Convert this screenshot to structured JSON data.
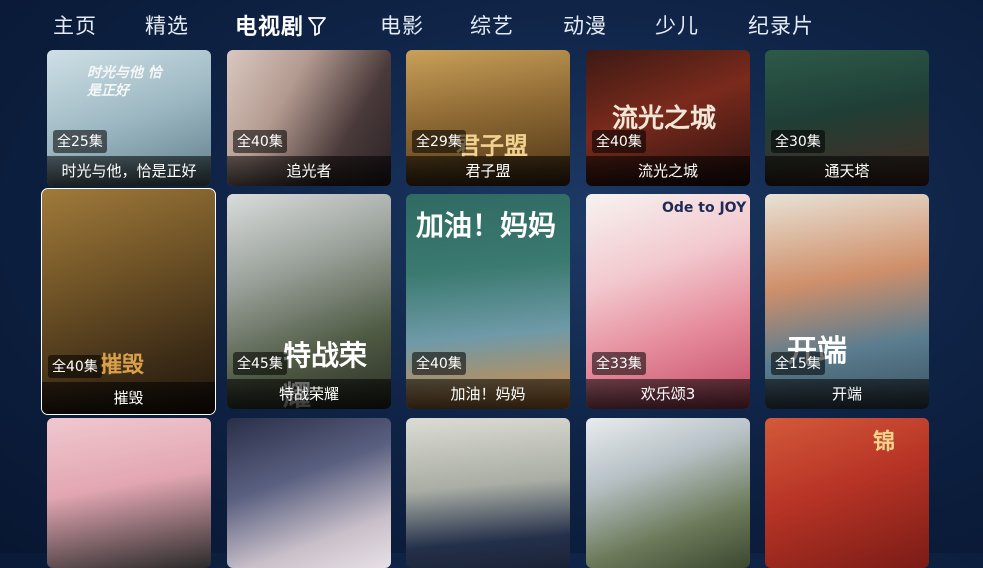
{
  "nav": {
    "items": [
      {
        "label": "主页"
      },
      {
        "label": "精选"
      },
      {
        "label": "电视剧"
      },
      {
        "label": "电影"
      },
      {
        "label": "综艺"
      },
      {
        "label": "动漫"
      },
      {
        "label": "少儿"
      },
      {
        "label": "纪录片"
      }
    ],
    "active_index": 2
  },
  "rows": [
    [
      {
        "title": "时光与他，恰是正好",
        "episodes": "全25集",
        "poster_text": "时光与他 恰是正好"
      },
      {
        "title": "追光者",
        "episodes": "全40集"
      },
      {
        "title": "君子盟",
        "episodes": "全29集",
        "poster_text": "君子盟"
      },
      {
        "title": "流光之城",
        "episodes": "全40集",
        "poster_text": "流光之城"
      },
      {
        "title": "通天塔",
        "episodes": "全30集"
      }
    ],
    [
      {
        "title": "摧毁",
        "episodes": "全40集",
        "poster_text": "摧毁"
      },
      {
        "title": "特战荣耀",
        "episodes": "全45集",
        "poster_text": "特战荣耀"
      },
      {
        "title": "加油！妈妈",
        "episodes": "全40集",
        "poster_text": "加油！妈妈"
      },
      {
        "title": "欢乐颂3",
        "episodes": "全33集",
        "poster_text": "Ode to JOY"
      },
      {
        "title": "开端",
        "episodes": "全15集",
        "poster_text": "开端"
      }
    ],
    [
      {
        "title": ""
      },
      {
        "title": ""
      },
      {
        "title": ""
      },
      {
        "title": ""
      },
      {
        "title": "",
        "poster_text": "锦"
      }
    ]
  ],
  "colors": {
    "background": "#0f2447",
    "focus_outline": "#ffffff"
  }
}
